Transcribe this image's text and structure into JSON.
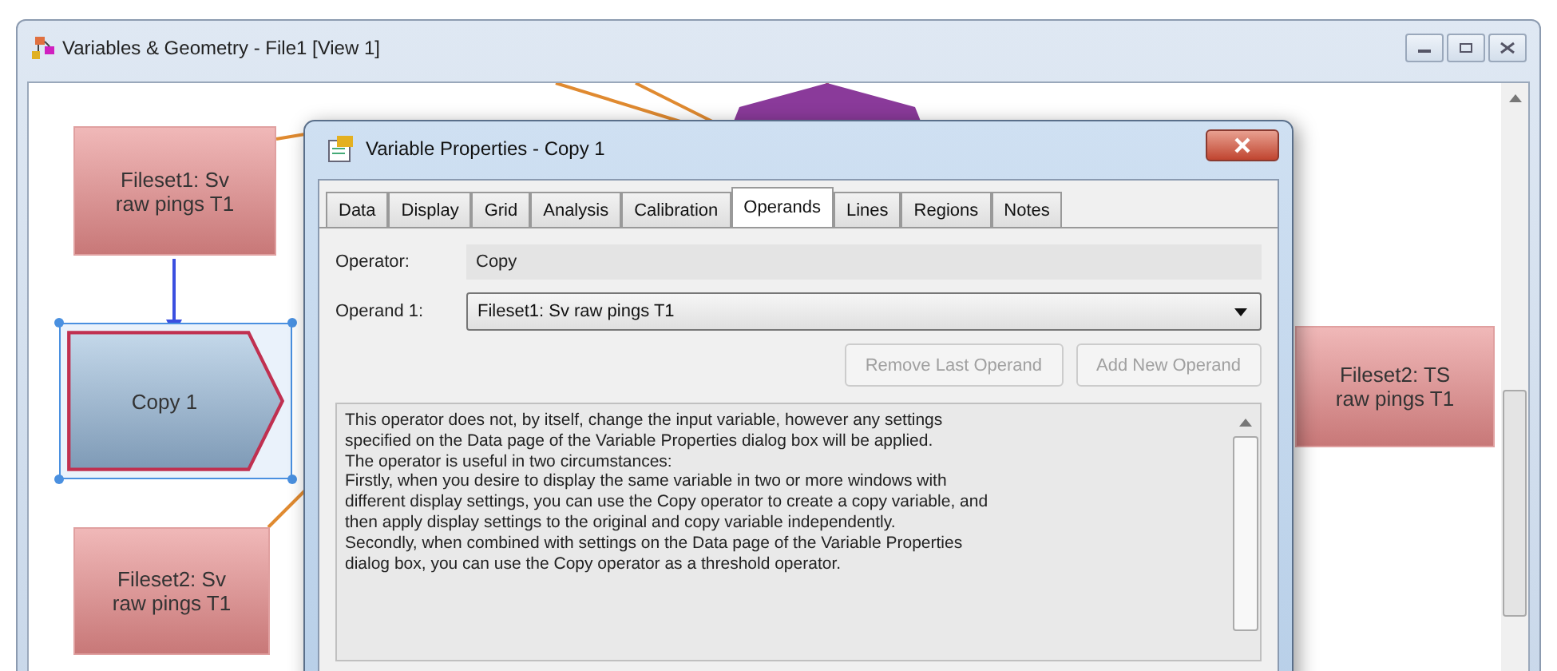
{
  "window": {
    "title": "Variables & Geometry - File1 [View 1]"
  },
  "canvas": {
    "nodes": [
      {
        "label": "Fileset1: Sv\nraw pings T1",
        "kind": "source",
        "selected": false
      },
      {
        "label": "Copy 1",
        "kind": "operator",
        "selected": true
      },
      {
        "label": "Fileset2: Sv\nraw pings T1",
        "kind": "source",
        "selected": false
      },
      {
        "label": "Fileset2: TS\nraw pings T1",
        "kind": "source",
        "selected": false
      }
    ]
  },
  "dialog": {
    "title": "Variable Properties - Copy 1",
    "tabs": [
      {
        "label": "Data",
        "selected": false
      },
      {
        "label": "Display",
        "selected": false
      },
      {
        "label": "Grid",
        "selected": false
      },
      {
        "label": "Analysis",
        "selected": false
      },
      {
        "label": "Calibration",
        "selected": false
      },
      {
        "label": "Operands",
        "selected": true
      },
      {
        "label": "Lines",
        "selected": false
      },
      {
        "label": "Regions",
        "selected": false
      },
      {
        "label": "Notes",
        "selected": false
      }
    ],
    "operator": {
      "label": "Operator:",
      "value": "Copy"
    },
    "operand": {
      "label": "Operand 1:",
      "value": "Fileset1: Sv raw pings T1"
    },
    "buttons": [
      {
        "label": "Remove Last Operand",
        "disabled": true
      },
      {
        "label": "Add New Operand",
        "disabled": true
      }
    ],
    "description": [
      "This operator does not, by itself, change the input variable, however any settings",
      "specified on the Data page of the Variable Properties dialog box will be applied.",
      "The operator is useful in two circumstances:",
      "Firstly, when you desire to display the same variable in two or more windows with",
      "different display settings, you can use the Copy operator to create a copy variable, and",
      "then apply display settings to the original and copy variable independently.",
      "Secondly, when combined with settings on the Data page of the Variable Properties",
      "dialog box, you can use the Copy operator as a threshold operator."
    ]
  }
}
